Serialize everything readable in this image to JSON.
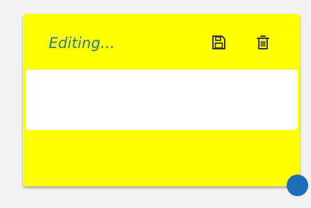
{
  "note": {
    "status_label": "Editing...",
    "body_text": "",
    "background_color": "#ffff00",
    "status_color": "#2a7a8c"
  },
  "toolbar": {
    "save_icon": "floppy-disk-icon",
    "delete_icon": "trash-icon"
  },
  "resize_handle": {
    "color": "#1f6fb8"
  }
}
